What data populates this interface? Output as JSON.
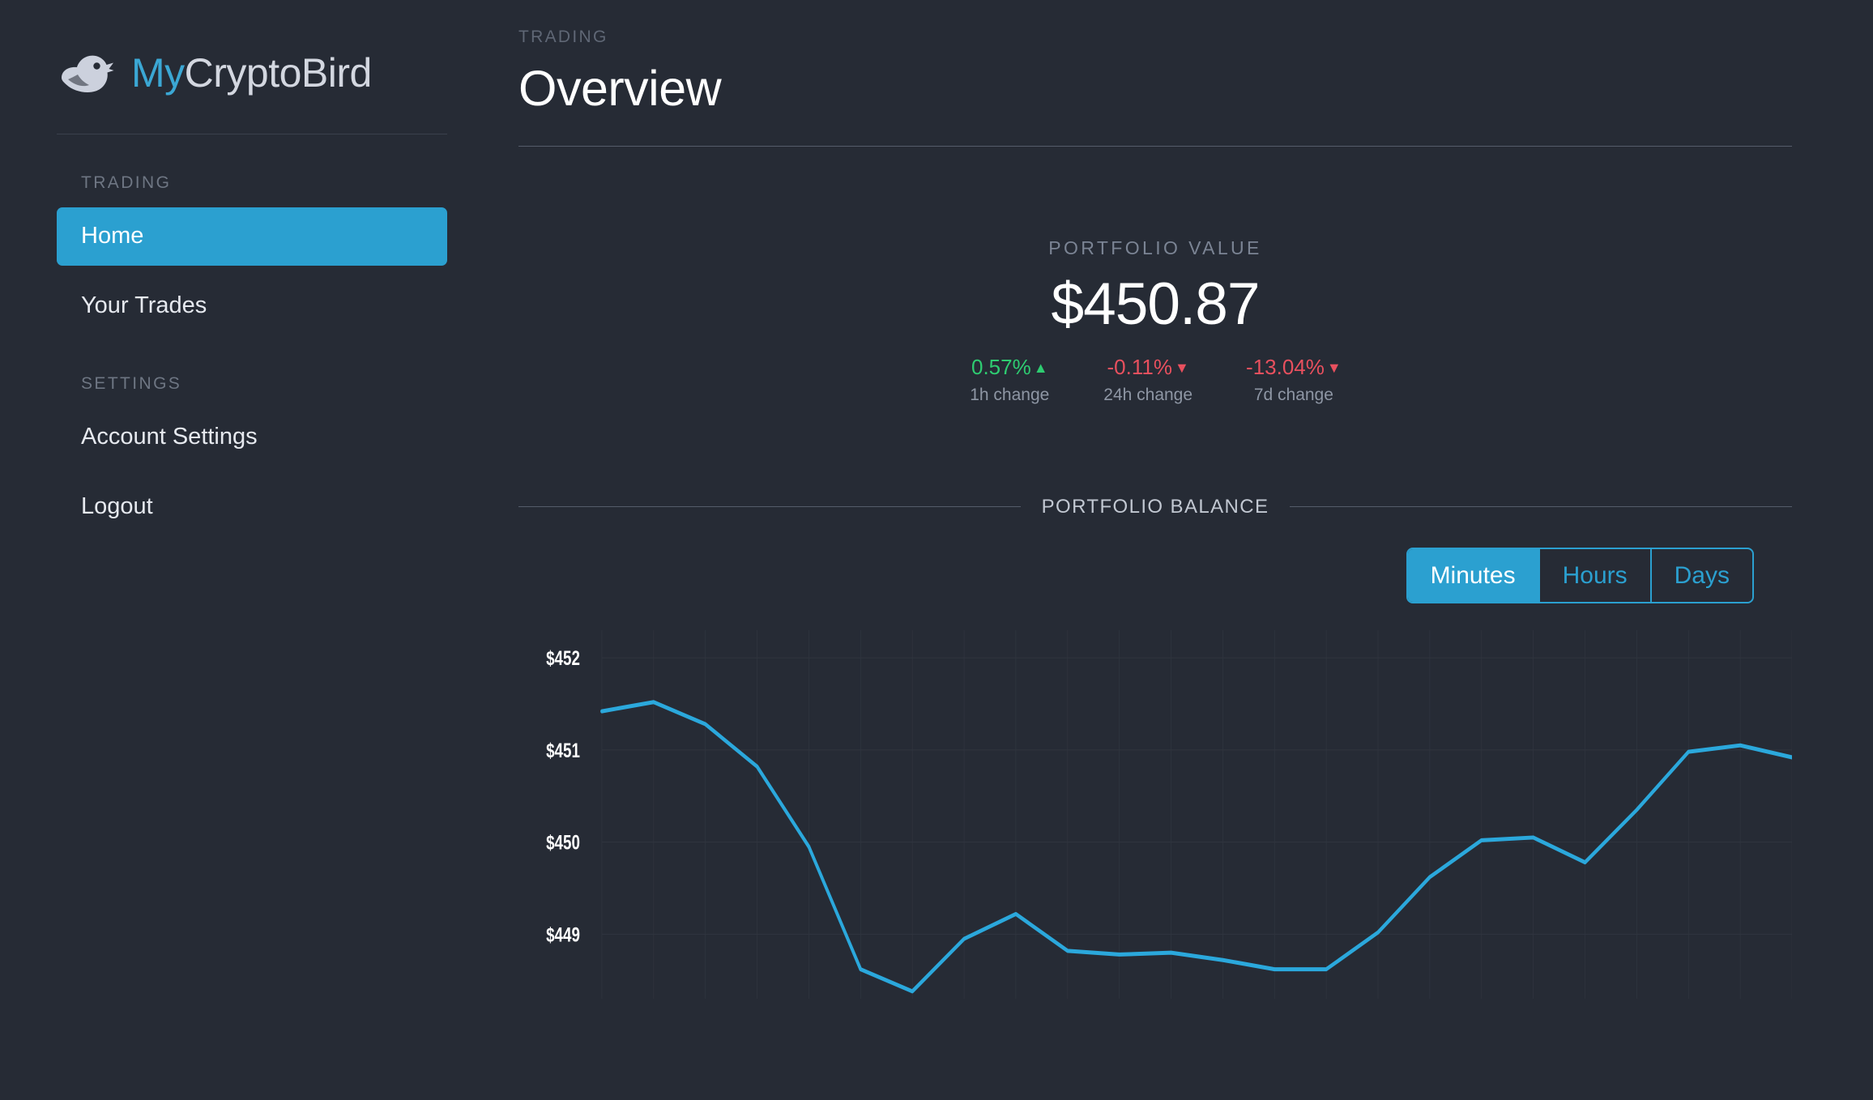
{
  "brand": {
    "icon": "bird-icon",
    "name_accent": "My",
    "name_rest": "CryptoBird",
    "accent_color": "#3ba7d4"
  },
  "sidebar": {
    "sections": [
      {
        "label": "TRADING",
        "items": [
          {
            "label": "Home",
            "active": true
          },
          {
            "label": "Your Trades",
            "active": false
          }
        ]
      },
      {
        "label": "SETTINGS",
        "items": [
          {
            "label": "Account Settings",
            "active": false
          },
          {
            "label": "Logout",
            "active": false
          }
        ]
      }
    ]
  },
  "header": {
    "eyebrow": "TRADING",
    "title": "Overview"
  },
  "portfolio": {
    "label": "PORTFOLIO VALUE",
    "amount": "$450.87",
    "changes": [
      {
        "value": "0.57%",
        "direction": "up",
        "arrow": "▲",
        "caption": "1h change",
        "color": "#2ecc71"
      },
      {
        "value": "-0.11%",
        "direction": "down",
        "arrow": "▼",
        "caption": "24h change",
        "color": "#e8505e"
      },
      {
        "value": "-13.04%",
        "direction": "down",
        "arrow": "▼",
        "caption": "7d change",
        "color": "#e8505e"
      }
    ]
  },
  "balance_section": {
    "label": "PORTFOLIO BALANCE",
    "timeframes": [
      {
        "label": "Minutes",
        "active": true
      },
      {
        "label": "Hours",
        "active": false
      },
      {
        "label": "Days",
        "active": false
      }
    ]
  },
  "chart_data": {
    "type": "line",
    "title": "PORTFOLIO BALANCE",
    "xlabel": "",
    "ylabel": "",
    "ylim": [
      448.3,
      452.3
    ],
    "yticks": [
      452,
      451,
      450,
      449
    ],
    "ytick_labels": [
      "$452",
      "$451",
      "$450",
      "$449"
    ],
    "grid": true,
    "legend": false,
    "line_color": "#2ba8dc",
    "x": [
      0,
      1,
      2,
      3,
      4,
      5,
      6,
      7,
      8,
      9,
      10,
      11,
      12,
      13,
      14,
      15,
      16,
      17,
      18,
      19,
      20,
      21,
      22,
      23
    ],
    "values": [
      451.42,
      451.52,
      451.28,
      450.82,
      449.95,
      448.62,
      448.38,
      448.95,
      449.22,
      448.82,
      448.78,
      448.8,
      448.72,
      448.62,
      448.62,
      449.02,
      449.62,
      450.02,
      450.05,
      449.78,
      450.35,
      450.98,
      451.05,
      450.92
    ]
  }
}
